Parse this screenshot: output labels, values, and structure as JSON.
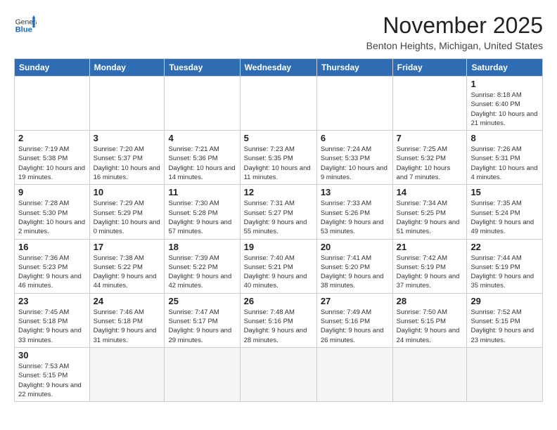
{
  "logo": {
    "general": "General",
    "blue": "Blue"
  },
  "header": {
    "month": "November 2025",
    "location": "Benton Heights, Michigan, United States"
  },
  "weekdays": [
    "Sunday",
    "Monday",
    "Tuesday",
    "Wednesday",
    "Thursday",
    "Friday",
    "Saturday"
  ],
  "weeks": [
    [
      {
        "day": "",
        "info": ""
      },
      {
        "day": "",
        "info": ""
      },
      {
        "day": "",
        "info": ""
      },
      {
        "day": "",
        "info": ""
      },
      {
        "day": "",
        "info": ""
      },
      {
        "day": "",
        "info": ""
      },
      {
        "day": "1",
        "info": "Sunrise: 8:18 AM\nSunset: 6:40 PM\nDaylight: 10 hours and 21 minutes."
      }
    ],
    [
      {
        "day": "2",
        "info": "Sunrise: 7:19 AM\nSunset: 5:38 PM\nDaylight: 10 hours and 19 minutes."
      },
      {
        "day": "3",
        "info": "Sunrise: 7:20 AM\nSunset: 5:37 PM\nDaylight: 10 hours and 16 minutes."
      },
      {
        "day": "4",
        "info": "Sunrise: 7:21 AM\nSunset: 5:36 PM\nDaylight: 10 hours and 14 minutes."
      },
      {
        "day": "5",
        "info": "Sunrise: 7:23 AM\nSunset: 5:35 PM\nDaylight: 10 hours and 11 minutes."
      },
      {
        "day": "6",
        "info": "Sunrise: 7:24 AM\nSunset: 5:33 PM\nDaylight: 10 hours and 9 minutes."
      },
      {
        "day": "7",
        "info": "Sunrise: 7:25 AM\nSunset: 5:32 PM\nDaylight: 10 hours and 7 minutes."
      },
      {
        "day": "8",
        "info": "Sunrise: 7:26 AM\nSunset: 5:31 PM\nDaylight: 10 hours and 4 minutes."
      }
    ],
    [
      {
        "day": "9",
        "info": "Sunrise: 7:28 AM\nSunset: 5:30 PM\nDaylight: 10 hours and 2 minutes."
      },
      {
        "day": "10",
        "info": "Sunrise: 7:29 AM\nSunset: 5:29 PM\nDaylight: 10 hours and 0 minutes."
      },
      {
        "day": "11",
        "info": "Sunrise: 7:30 AM\nSunset: 5:28 PM\nDaylight: 9 hours and 57 minutes."
      },
      {
        "day": "12",
        "info": "Sunrise: 7:31 AM\nSunset: 5:27 PM\nDaylight: 9 hours and 55 minutes."
      },
      {
        "day": "13",
        "info": "Sunrise: 7:33 AM\nSunset: 5:26 PM\nDaylight: 9 hours and 53 minutes."
      },
      {
        "day": "14",
        "info": "Sunrise: 7:34 AM\nSunset: 5:25 PM\nDaylight: 9 hours and 51 minutes."
      },
      {
        "day": "15",
        "info": "Sunrise: 7:35 AM\nSunset: 5:24 PM\nDaylight: 9 hours and 49 minutes."
      }
    ],
    [
      {
        "day": "16",
        "info": "Sunrise: 7:36 AM\nSunset: 5:23 PM\nDaylight: 9 hours and 46 minutes."
      },
      {
        "day": "17",
        "info": "Sunrise: 7:38 AM\nSunset: 5:22 PM\nDaylight: 9 hours and 44 minutes."
      },
      {
        "day": "18",
        "info": "Sunrise: 7:39 AM\nSunset: 5:22 PM\nDaylight: 9 hours and 42 minutes."
      },
      {
        "day": "19",
        "info": "Sunrise: 7:40 AM\nSunset: 5:21 PM\nDaylight: 9 hours and 40 minutes."
      },
      {
        "day": "20",
        "info": "Sunrise: 7:41 AM\nSunset: 5:20 PM\nDaylight: 9 hours and 38 minutes."
      },
      {
        "day": "21",
        "info": "Sunrise: 7:42 AM\nSunset: 5:19 PM\nDaylight: 9 hours and 37 minutes."
      },
      {
        "day": "22",
        "info": "Sunrise: 7:44 AM\nSunset: 5:19 PM\nDaylight: 9 hours and 35 minutes."
      }
    ],
    [
      {
        "day": "23",
        "info": "Sunrise: 7:45 AM\nSunset: 5:18 PM\nDaylight: 9 hours and 33 minutes."
      },
      {
        "day": "24",
        "info": "Sunrise: 7:46 AM\nSunset: 5:18 PM\nDaylight: 9 hours and 31 minutes."
      },
      {
        "day": "25",
        "info": "Sunrise: 7:47 AM\nSunset: 5:17 PM\nDaylight: 9 hours and 29 minutes."
      },
      {
        "day": "26",
        "info": "Sunrise: 7:48 AM\nSunset: 5:16 PM\nDaylight: 9 hours and 28 minutes."
      },
      {
        "day": "27",
        "info": "Sunrise: 7:49 AM\nSunset: 5:16 PM\nDaylight: 9 hours and 26 minutes."
      },
      {
        "day": "28",
        "info": "Sunrise: 7:50 AM\nSunset: 5:15 PM\nDaylight: 9 hours and 24 minutes."
      },
      {
        "day": "29",
        "info": "Sunrise: 7:52 AM\nSunset: 5:15 PM\nDaylight: 9 hours and 23 minutes."
      }
    ],
    [
      {
        "day": "30",
        "info": "Sunrise: 7:53 AM\nSunset: 5:15 PM\nDaylight: 9 hours and 22 minutes."
      },
      {
        "day": "",
        "info": ""
      },
      {
        "day": "",
        "info": ""
      },
      {
        "day": "",
        "info": ""
      },
      {
        "day": "",
        "info": ""
      },
      {
        "day": "",
        "info": ""
      },
      {
        "day": "",
        "info": ""
      }
    ]
  ]
}
